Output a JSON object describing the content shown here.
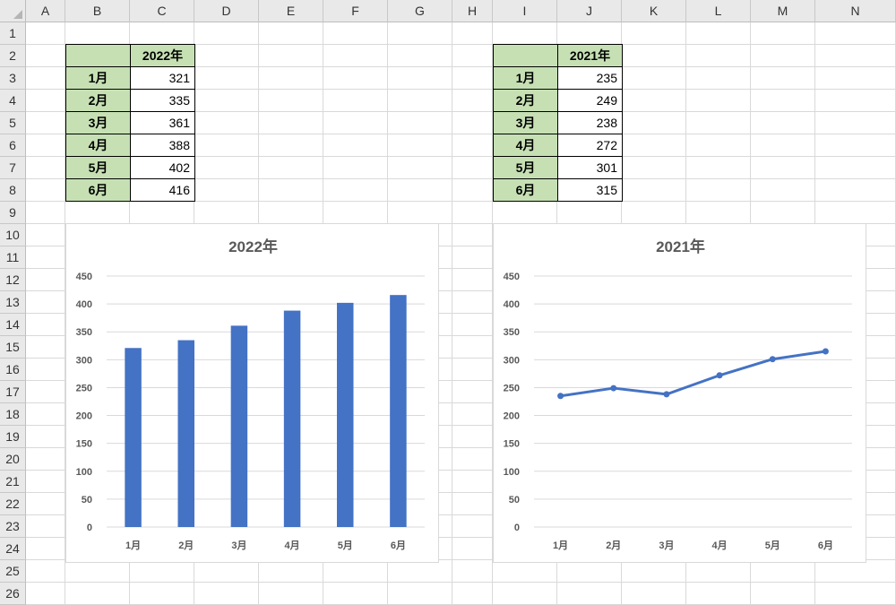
{
  "columns": [
    "A",
    "B",
    "C",
    "D",
    "E",
    "F",
    "G",
    "H",
    "I",
    "J",
    "K",
    "L",
    "M",
    "N"
  ],
  "rows": [
    "1",
    "2",
    "3",
    "4",
    "5",
    "6",
    "7",
    "8",
    "9",
    "10",
    "11",
    "12",
    "13",
    "14",
    "15",
    "16",
    "17",
    "18",
    "19",
    "20",
    "21",
    "22",
    "23",
    "24",
    "25",
    "26"
  ],
  "table_2022": {
    "header": "2022年",
    "rows": [
      {
        "month": "1月",
        "value": "321"
      },
      {
        "month": "2月",
        "value": "335"
      },
      {
        "month": "3月",
        "value": "361"
      },
      {
        "month": "4月",
        "value": "388"
      },
      {
        "month": "5月",
        "value": "402"
      },
      {
        "month": "6月",
        "value": "416"
      }
    ]
  },
  "table_2021": {
    "header": "2021年",
    "rows": [
      {
        "month": "1月",
        "value": "235"
      },
      {
        "month": "2月",
        "value": "249"
      },
      {
        "month": "3月",
        "value": "238"
      },
      {
        "month": "4月",
        "value": "272"
      },
      {
        "month": "5月",
        "value": "301"
      },
      {
        "month": "6月",
        "value": "315"
      }
    ]
  },
  "colors": {
    "series": "#4472c4",
    "header_fill": "#c6e0b4",
    "gridline": "#d9d9d9",
    "axis_text": "#595959"
  },
  "chart_data": [
    {
      "type": "bar",
      "title": "2022年",
      "categories": [
        "1月",
        "2月",
        "3月",
        "4月",
        "5月",
        "6月"
      ],
      "values": [
        321,
        335,
        361,
        388,
        402,
        416
      ],
      "ylim": [
        0,
        450
      ],
      "yticks": [
        0,
        50,
        100,
        150,
        200,
        250,
        300,
        350,
        400,
        450
      ],
      "grid": true,
      "legend": "none"
    },
    {
      "type": "line",
      "title": "2021年",
      "categories": [
        "1月",
        "2月",
        "3月",
        "4月",
        "5月",
        "6月"
      ],
      "values": [
        235,
        249,
        238,
        272,
        301,
        315
      ],
      "ylim": [
        0,
        450
      ],
      "yticks": [
        0,
        50,
        100,
        150,
        200,
        250,
        300,
        350,
        400,
        450
      ],
      "grid": true,
      "legend": "none"
    }
  ]
}
